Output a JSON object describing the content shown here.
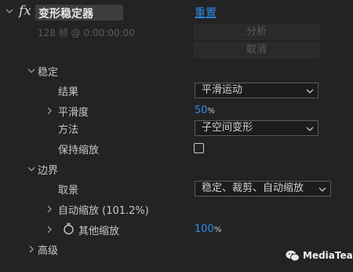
{
  "effect": {
    "fx": "fx",
    "name": "变形稳定器",
    "reset": "重置"
  },
  "analysis": {
    "status": "128 帧 @ 0:00:00:00",
    "analyze_button": "分析",
    "cancel_button": "取消"
  },
  "stabilize": {
    "group_label": "稳定",
    "result": {
      "label": "结果",
      "value": "平滑运动"
    },
    "smoothness": {
      "label": "平滑度",
      "value": "50",
      "unit": "%"
    },
    "method": {
      "label": "方法",
      "value": "子空间变形"
    },
    "preserve_scale": {
      "label": "保持缩放",
      "checked": false
    }
  },
  "borders": {
    "group_label": "边界",
    "framing": {
      "label": "取景",
      "value": "稳定、裁剪、自动缩放"
    },
    "auto_scale": {
      "label": "自动缩放 (101.2%)"
    },
    "additional_scale": {
      "label": "其他缩放",
      "value": "100",
      "unit": "%"
    }
  },
  "advanced": {
    "group_label": "高级"
  },
  "watermark": {
    "text": "MediaTea"
  }
}
